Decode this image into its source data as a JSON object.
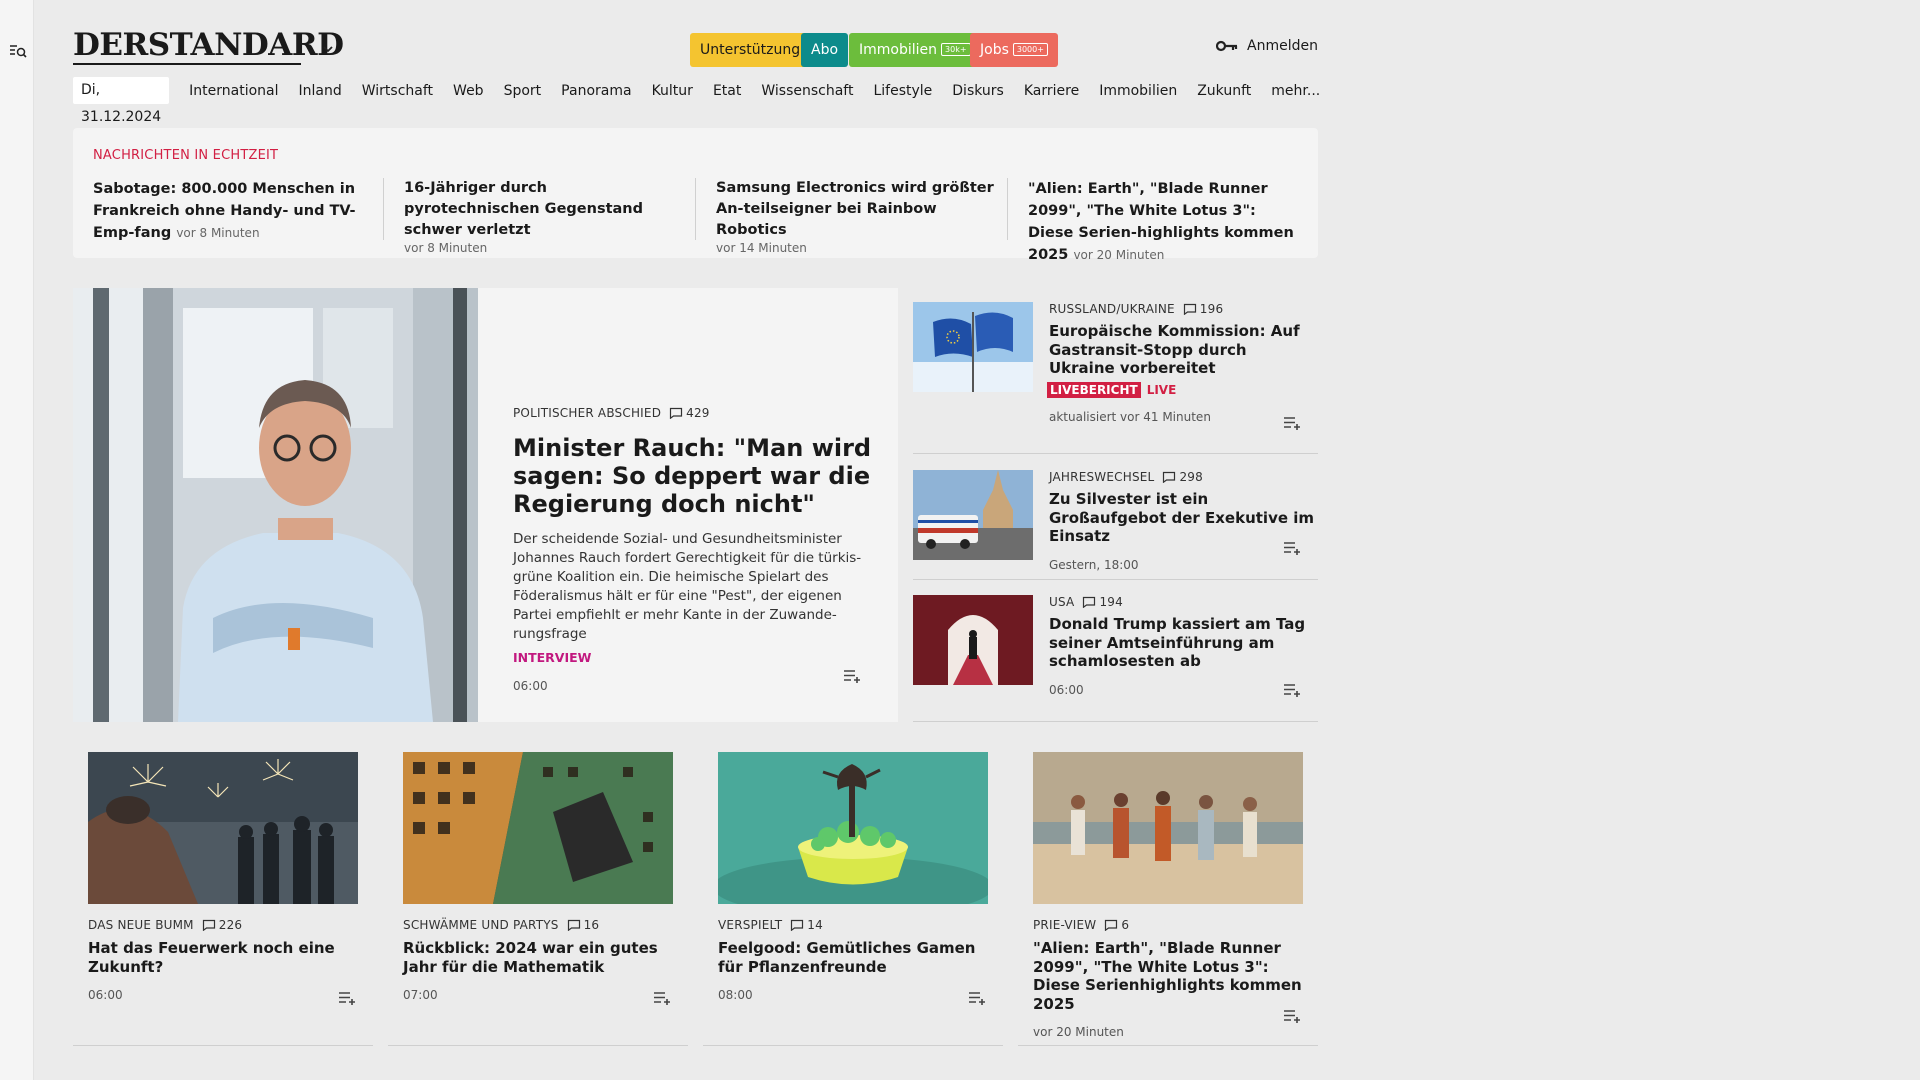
{
  "header": {
    "logo": "DERSTANDARD",
    "buttons": {
      "support": "Unterstützung",
      "abo": "Abo",
      "immobilien": "Immobilien",
      "immobilien_badge": "30k+",
      "jobs": "Jobs",
      "jobs_badge": "3000+"
    },
    "login": "Anmelden"
  },
  "nav": {
    "date": "Di, 31.12.2024",
    "items": [
      "International",
      "Inland",
      "Wirtschaft",
      "Web",
      "Sport",
      "Panorama",
      "Kultur",
      "Etat",
      "Wissenschaft",
      "Lifestyle",
      "Diskurs",
      "Karriere",
      "Immobilien",
      "Zukunft",
      "mehr..."
    ]
  },
  "ticker": {
    "title": "NACHRICHTEN IN ECHTZEIT",
    "items": [
      {
        "headline": "Sabotage: 800.000 Menschen in Frankreich ohne Handy- und TV-Emp-fang",
        "time": "vor 8 Minuten"
      },
      {
        "headline": "16-Jähriger durch pyrotechnischen Gegenstand schwer verletzt",
        "time": "vor 8 Minuten"
      },
      {
        "headline": "Samsung Electronics wird größter An-teilseigner bei Rainbow Robotics",
        "time": "vor 14 Minuten"
      },
      {
        "headline": "\"Alien: Earth\", \"Blade Runner 2099\", \"The White Lotus 3\": Diese Serien-highlights kommen 2025",
        "time": "vor 20 Minuten"
      }
    ]
  },
  "hero": {
    "kicker": "POLITISCHER ABSCHIED",
    "comments": "429",
    "title": "Minister Rauch: \"Man wird sagen: So deppert war die Regierung doch nicht\"",
    "lead": "Der scheidende Sozial- und Gesundheitsminister Johannes Rauch fordert Gerechtigkeit für die türkis-grüne Koalition ein. Die heimische Spielart des Föderalismus hält er für eine \"Pest\", der eigenen Partei empfiehlt er mehr Kante in der Zuwande-rungsfrage",
    "label": "INTERVIEW",
    "time": "06:00"
  },
  "side": [
    {
      "kicker": "RUSSLAND/UKRAINE",
      "comments": "196",
      "title": "Europäische Kommission: Auf Gastransit-Stopp durch Ukraine vorbereitet",
      "live_badge": "LIVEBERICHT",
      "live_text": "LIVE",
      "time": "aktualisiert vor 41 Minuten"
    },
    {
      "kicker": "JAHRESWECHSEL",
      "comments": "298",
      "title": "Zu Silvester ist ein Großaufgebot der Exekutive im Einsatz",
      "time": "Gestern, 18:00"
    },
    {
      "kicker": "USA",
      "comments": "194",
      "title": "Donald Trump kassiert am Tag seiner Amtseinführung am schamlosesten ab",
      "time": "06:00"
    }
  ],
  "cards": [
    {
      "kicker": "DAS NEUE BUMM",
      "comments": "226",
      "title": "Hat das Feuerwerk noch eine Zukunft?",
      "time": "06:00"
    },
    {
      "kicker": "SCHWÄMME UND PARTYS",
      "comments": "16",
      "title": "Rückblick: 2024 war ein gutes Jahr für die Mathematik",
      "time": "07:00"
    },
    {
      "kicker": "VERSPIELT",
      "comments": "14",
      "title": "Feelgood: Gemütliches Gamen für Pflanzenfreunde",
      "time": "08:00"
    },
    {
      "kicker": "PRIE-VIEW",
      "comments": "6",
      "title": "\"Alien: Earth\", \"Blade Runner 2099\", \"The White Lotus 3\": Diese Serienhighlights kommen 2025",
      "time": "vor 20 Minuten"
    }
  ]
}
